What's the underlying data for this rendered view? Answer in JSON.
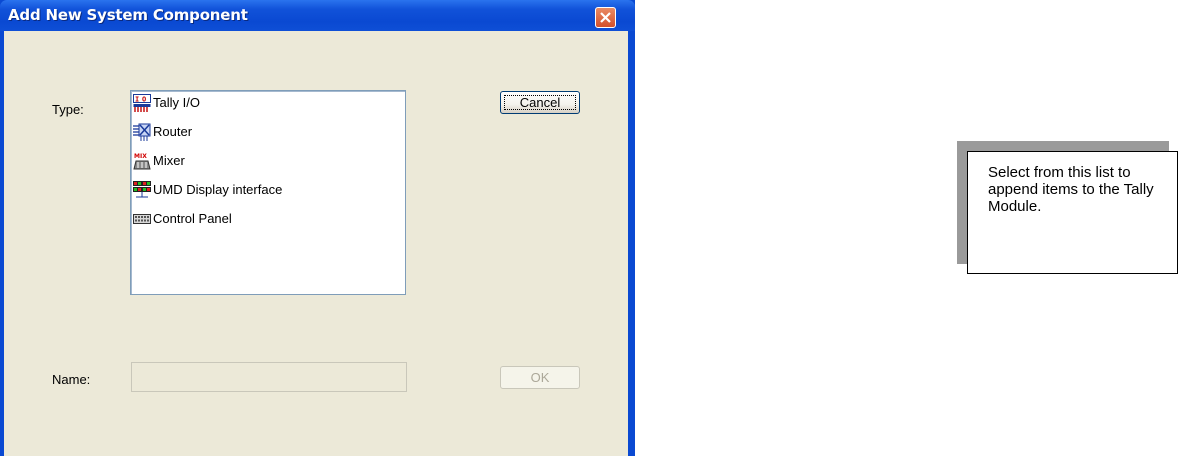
{
  "dialog": {
    "title": "Add New System Component",
    "type_label": "Type:",
    "name_label": "Name:",
    "name_value": "",
    "cancel_label": "Cancel",
    "ok_label": "OK",
    "items": [
      {
        "label": "Tally I/O",
        "icon": "tally-io-icon"
      },
      {
        "label": "Router",
        "icon": "router-icon"
      },
      {
        "label": "Mixer",
        "icon": "mixer-icon"
      },
      {
        "label": "UMD Display interface",
        "icon": "umd-display-icon"
      },
      {
        "label": "Control Panel",
        "icon": "control-panel-icon"
      }
    ]
  },
  "callout": {
    "text": "Select from this list to append items to the Tally Module."
  },
  "colors": {
    "titlebar": "#0a49d2",
    "dialog_face": "#ece9d8",
    "close_button": "#d4502b"
  }
}
